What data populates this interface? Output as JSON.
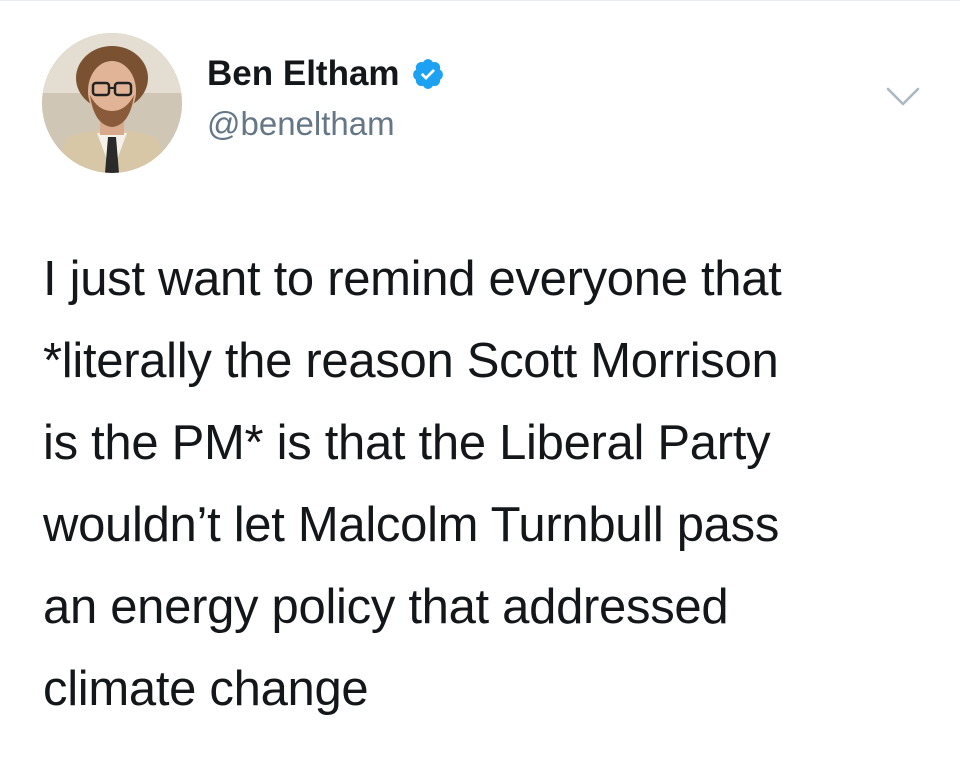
{
  "tweet": {
    "author": {
      "display_name": "Ben Eltham",
      "handle": "@beneltham",
      "verified": true,
      "avatar_icon": "user-avatar-photo"
    },
    "text": "I just want to remind everyone that\n*literally the reason Scott Morrison\nis the PM* is that the Liberal Party\nwouldn’t let Malcolm Turnbull pass\nan energy policy that addressed\nclimate change",
    "menu_icon": "chevron-down-icon"
  },
  "colors": {
    "text_primary": "#14171a",
    "text_secondary": "#657786",
    "verified_blue": "#1da1f2",
    "caret_gray": "#aab8c2"
  }
}
